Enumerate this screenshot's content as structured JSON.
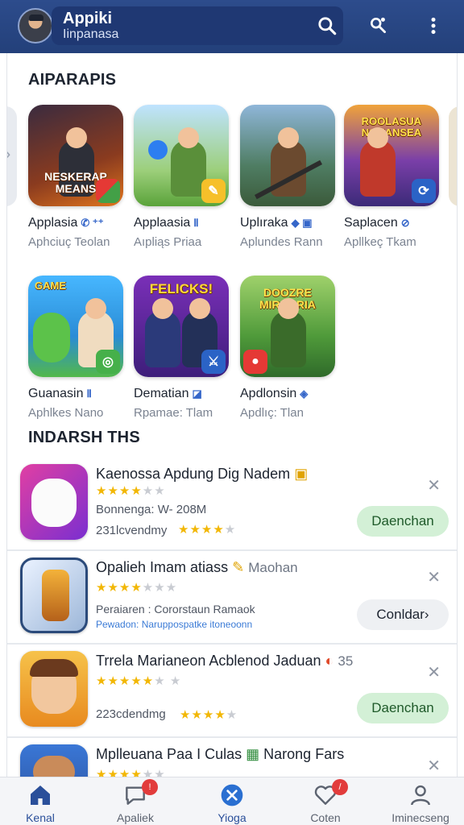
{
  "header": {
    "title": "Appiki",
    "subtitle": "Iinpanasa",
    "search_icon": "search-icon",
    "person_search_icon": "person-search-icon",
    "more_icon": "more-vertical-icon"
  },
  "apps_section": {
    "title": "AIPARAPIS",
    "cards": [
      {
        "name": "Applasia",
        "tag": "✆ ⁺⁺",
        "sub": "Aphciuç Teolan",
        "banner": "NESKERAP MEANS"
      },
      {
        "name": "Applaasia",
        "tag": "Ⅱ",
        "sub": "Aıpliąs Priaa",
        "banner": ""
      },
      {
        "name": "Uplıraka",
        "tag": "◆ ▣",
        "sub": "Aplundes Rann",
        "banner": ""
      },
      {
        "name": "Saplacen",
        "tag": "⊘",
        "sub": "Apllkeç Tkam",
        "banner": "ROOLASUA NOKANSEA"
      },
      {
        "name": "Guanasin",
        "tag": "Ⅱ",
        "sub": "Aphlkes Nano",
        "banner": "GAME"
      },
      {
        "name": "Dematian",
        "tag": "◪",
        "sub": "Rpamae: Tlam",
        "banner": "FELICKS!"
      },
      {
        "name": "Apdlonsin",
        "tag": "◈",
        "sub": "Apdlıç: Tlan",
        "banner": "DOOZRE MIRARRIA"
      }
    ]
  },
  "list_section": {
    "title": "INDARSH THS",
    "items": [
      {
        "title": "Kaenossa Apdung Dig Nadem",
        "title_extra": "",
        "meta": "Bonnenga: W- 208M",
        "meta2": "231lcvendmy",
        "meta_small": "",
        "button": "Daenchan",
        "rating": 4,
        "rating2": 3
      },
      {
        "title": "Opalieh Imam atiass",
        "title_extra": "Maohan",
        "meta": "Peraiaren : Cororstaun Ramaok",
        "meta2": "",
        "meta_small": "Pewadon: Naruppospatke itoneoonn",
        "button": "Conldar›",
        "rating": 3,
        "rating2": 0
      },
      {
        "title": "Trrela Marianeon Acblenod Jaduan",
        "title_extra": "35",
        "meta": "",
        "meta2": "223cdendmg",
        "meta_small": "",
        "button": "Daenchan",
        "rating": 5,
        "rating2": 3
      },
      {
        "title": "Mplleuana Paa I Culas",
        "title_extra": "Narong Fars",
        "meta": "",
        "meta2": "",
        "meta_small": "",
        "button": "",
        "rating": 4,
        "rating2": 0
      }
    ]
  },
  "bottom_nav": {
    "items": [
      {
        "label": "Kenal",
        "icon": "home-icon",
        "badge": ""
      },
      {
        "label": "Apaliek",
        "icon": "chat-heart-icon",
        "badge": "!"
      },
      {
        "label": "Yioga",
        "icon": "apps-circle-icon",
        "badge": ""
      },
      {
        "label": "Coten",
        "icon": "heart-icon",
        "badge": "/"
      },
      {
        "label": "Iminecseng",
        "icon": "profile-icon",
        "badge": ""
      }
    ]
  },
  "colors": {
    "header": "#23407a",
    "accent": "#2a4f9a",
    "install_button": "#d3f0d6",
    "star": "#f2b705",
    "badge": "#e23c3c"
  }
}
